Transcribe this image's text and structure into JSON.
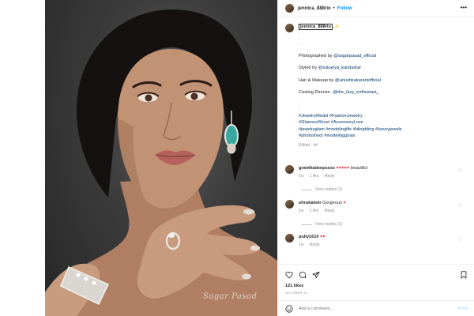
{
  "header": {
    "username": "jennica_888rio",
    "separator": "•",
    "follow_label": "Follow",
    "more_icon": "more-horizontal-icon"
  },
  "photo": {
    "watermark": "Sagar Pasad"
  },
  "caption": {
    "username": "jennica_888rio",
    "emoji": "✨",
    "dots_top": [
      ".",
      ".",
      "."
    ],
    "lines": [
      {
        "prefix": "Photographed by ",
        "handle": "@sagarpasad_official"
      },
      {
        "prefix": "Styled by ",
        "handle": "@sukanya_kandarkar"
      },
      {
        "prefix": "Hair & Makeup by ",
        "handle": "@anushkakaraniofficial"
      },
      {
        "prefix": "Casting Director -",
        "handle": "@the_lazy_enthusiast_"
      }
    ],
    "dots_bottom": [
      ".",
      ".",
      "."
    ],
    "hashtags": [
      "#JewelryModel #FashionJewelry",
      "#GlamourShoot #AccessoryLove",
      "#jewelryglam #modelinglife #blingbling #luxuryjewels",
      "#photoshoot #modelinggoals"
    ],
    "edited": "Edited · 4d"
  },
  "comments": [
    {
      "username": "granthadeepssss",
      "text": "beautiful",
      "hearts": "♥♥♥♥♥",
      "time": "1w",
      "likes": "1 like",
      "reply": "Reply",
      "view_replies": "View replies (1)"
    },
    {
      "username": "shrutiamin",
      "text": "Gorgeous",
      "hearts": "♥",
      "time": "1w",
      "likes": "1 like",
      "reply": "Reply",
      "view_replies": "View replies (1)"
    },
    {
      "username": "pully1610",
      "text": "",
      "hearts": "♥♥",
      "time": "1w",
      "likes": "",
      "reply": "Reply",
      "view_replies": ""
    }
  ],
  "actions": {
    "icons": [
      "heart-icon",
      "comment-icon",
      "share-icon",
      "save-icon"
    ]
  },
  "likes": "121 likes",
  "date": "OCTOBER 20",
  "add_comment": {
    "placeholder": "Add a comment...",
    "post_label": "Post",
    "emoji_icon": "smiley-icon"
  },
  "colors": {
    "accent": "#0095f6",
    "link": "#00376b",
    "heart": "#ed4956",
    "muted": "#8e8e8e"
  }
}
